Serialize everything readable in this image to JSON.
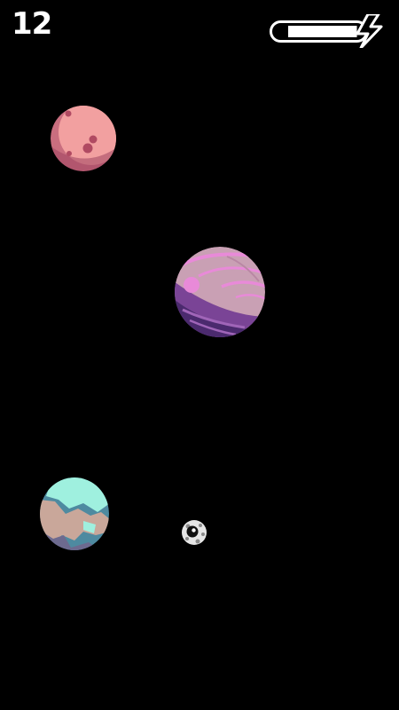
{
  "hud": {
    "score": "12",
    "energy_level": 0.76,
    "energy_icon": "lightning-bolt-icon"
  },
  "colors": {
    "background": "#000000",
    "hud": "#ffffff"
  },
  "objects": {
    "planets": [
      {
        "name": "planet-red",
        "palette": [
          "#f2a0a0",
          "#c96e7f",
          "#9e4460"
        ]
      },
      {
        "name": "planet-purple",
        "palette": [
          "#c9a0b4",
          "#e88ad8",
          "#7a4496",
          "#4b2a6e"
        ]
      },
      {
        "name": "planet-earth",
        "palette": [
          "#9ff0df",
          "#c9a79a",
          "#6d6a8f",
          "#4e8aa0"
        ]
      }
    ],
    "ball_icon": "eye-ball-icon"
  }
}
